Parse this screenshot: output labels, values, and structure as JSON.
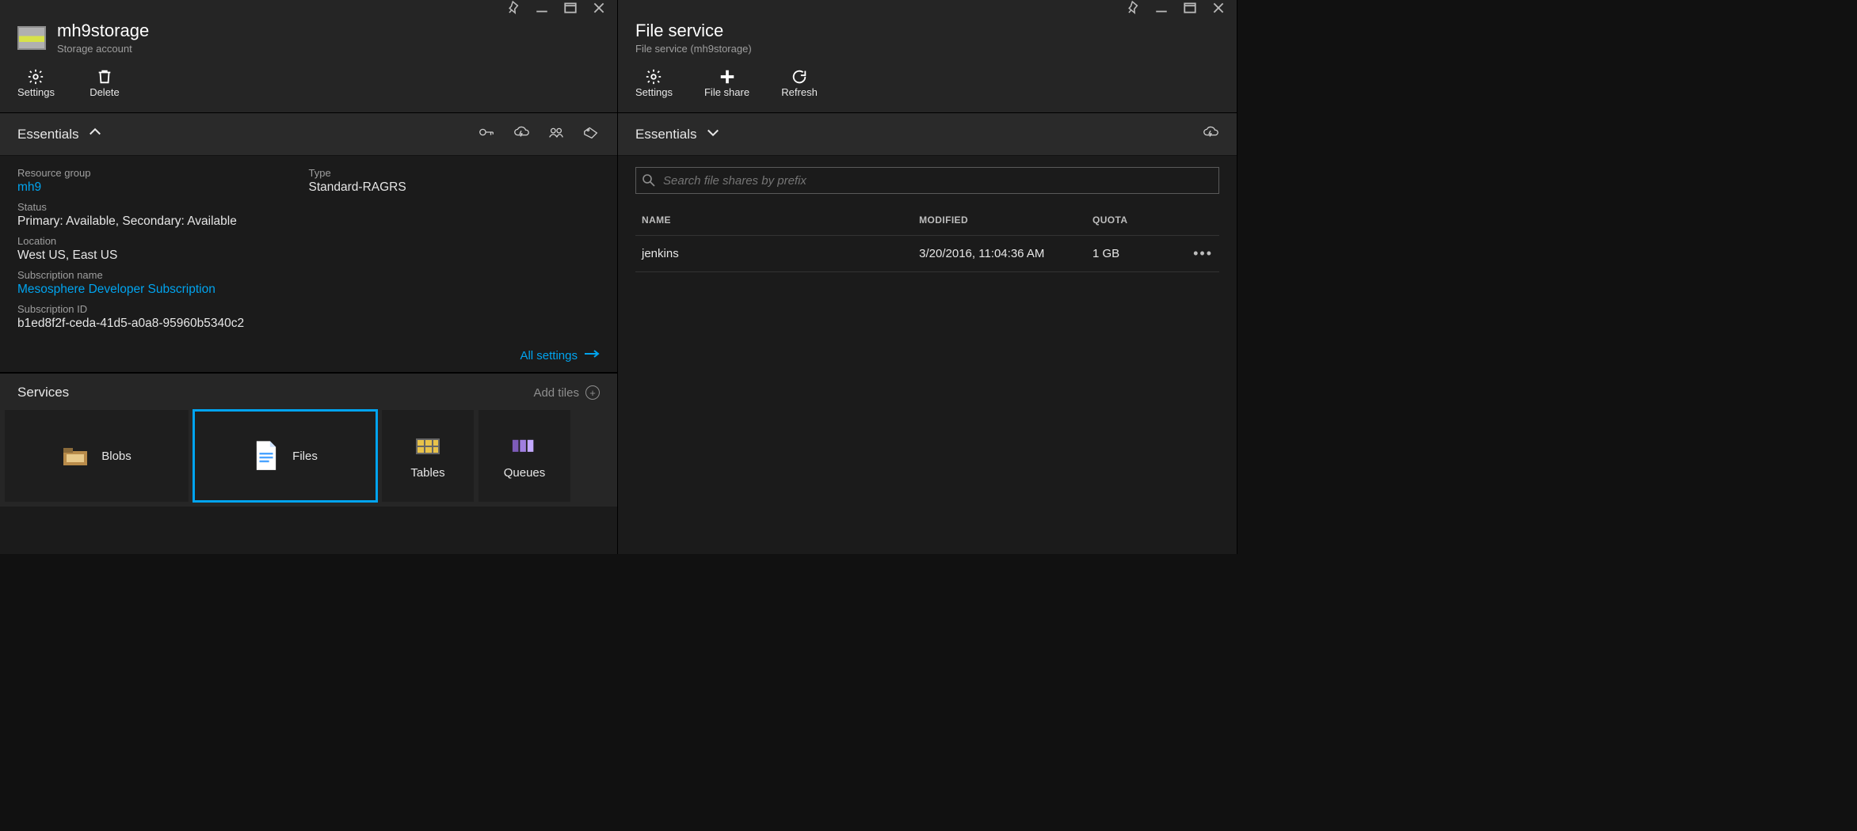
{
  "left": {
    "title": "mh9storage",
    "subtitle": "Storage account",
    "commands": {
      "settings": "Settings",
      "delete": "Delete"
    },
    "essentials_label": "Essentials",
    "fields": {
      "resource_group_label": "Resource group",
      "resource_group_value": "mh9",
      "status_label": "Status",
      "status_value": "Primary: Available, Secondary: Available",
      "location_label": "Location",
      "location_value": "West US, East US",
      "subscription_name_label": "Subscription name",
      "subscription_name_value": "Mesosphere Developer Subscription",
      "subscription_id_label": "Subscription ID",
      "subscription_id_value": "b1ed8f2f-ceda-41d5-a0a8-95960b5340c2",
      "type_label": "Type",
      "type_value": "Standard-RAGRS"
    },
    "all_settings": "All settings",
    "services_label": "Services",
    "add_tiles": "Add tiles",
    "tiles": {
      "blobs": "Blobs",
      "files": "Files",
      "tables": "Tables",
      "queues": "Queues"
    }
  },
  "right": {
    "title": "File service",
    "subtitle": "File service (mh9storage)",
    "commands": {
      "settings": "Settings",
      "fileshare": "File share",
      "refresh": "Refresh"
    },
    "essentials_label": "Essentials",
    "search_placeholder": "Search file shares by prefix",
    "columns": {
      "name": "NAME",
      "modified": "MODIFIED",
      "quota": "QUOTA"
    },
    "rows": [
      {
        "name": "jenkins",
        "modified": "3/20/2016, 11:04:36 AM",
        "quota": "1 GB"
      }
    ]
  }
}
